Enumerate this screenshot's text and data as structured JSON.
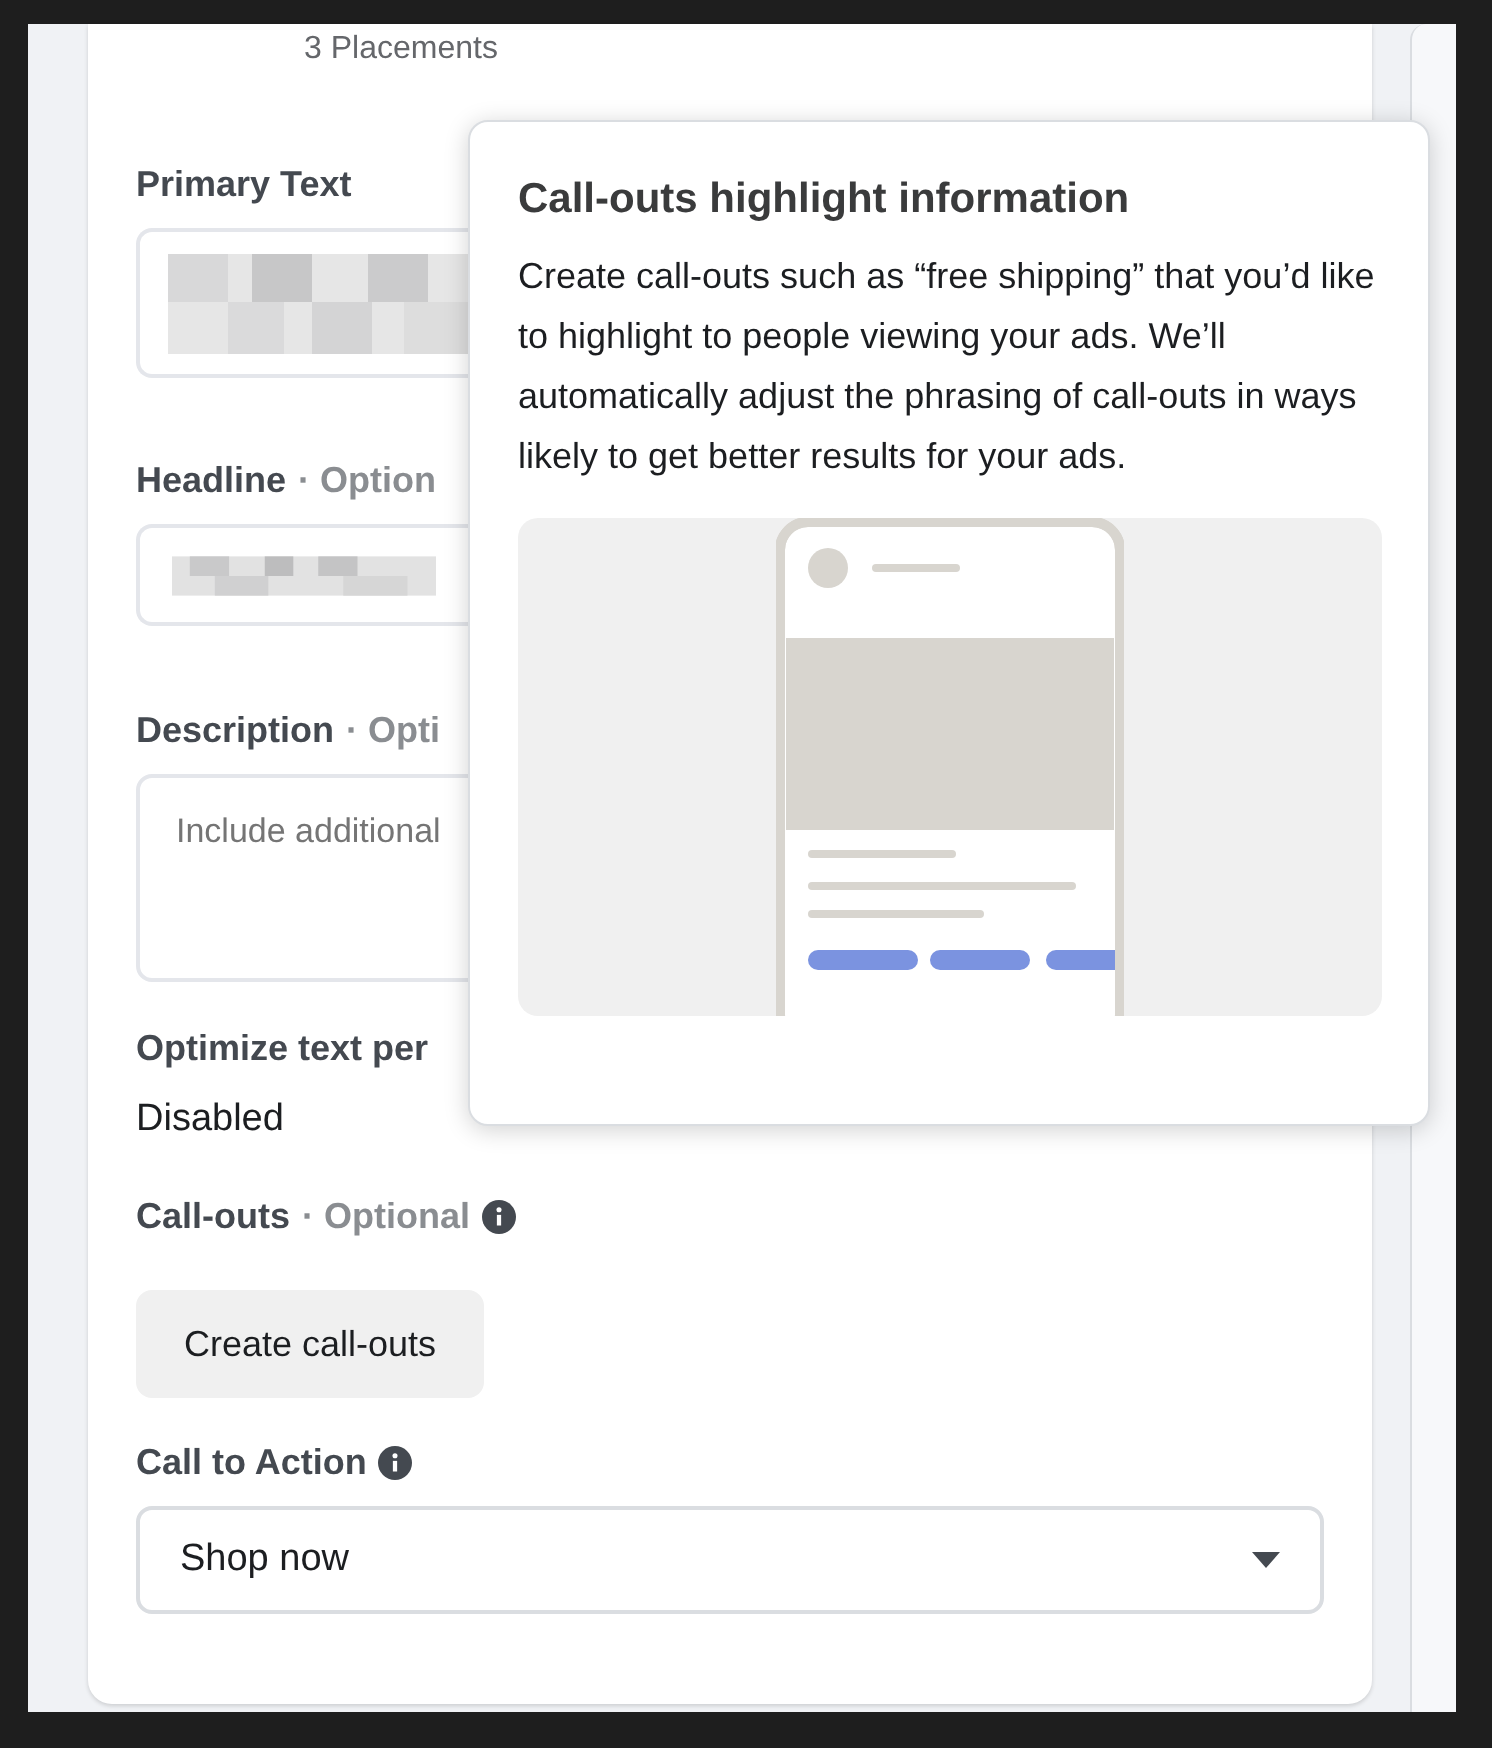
{
  "placements": "3 Placements",
  "primary_text": {
    "label": "Primary Text"
  },
  "headline": {
    "label": "Headline",
    "optional": "· Option"
  },
  "description": {
    "label": "Description",
    "optional": "· Opti",
    "placeholder": "Include additional"
  },
  "optimize": {
    "label": "Optimize text per",
    "value": "Disabled"
  },
  "callouts": {
    "label": "Call-outs",
    "optional": "· Optional",
    "button": "Create call-outs"
  },
  "call_to_action": {
    "label": "Call to Action",
    "value": "Shop now"
  },
  "tooltip": {
    "title": "Call-outs highlight information",
    "body": "Create call-outs such as “free shipping” that you’d like to highlight to people viewing your ads. We’ll automatically adjust the phrasing of call-outs in ways likely to get better results for your ads."
  }
}
